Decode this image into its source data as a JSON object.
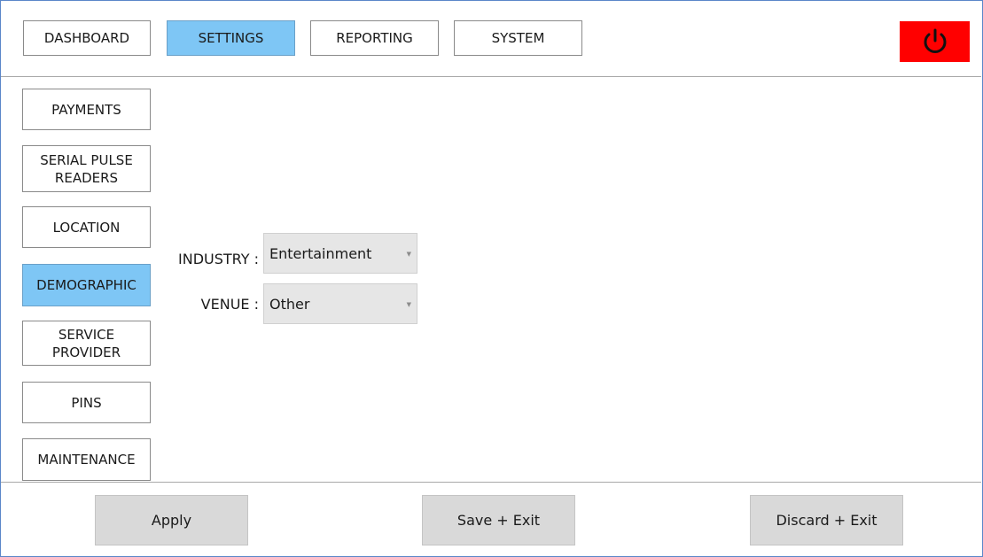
{
  "topnav": {
    "dashboard": "DASHBOARD",
    "settings": "SETTINGS",
    "reporting": "REPORTING",
    "system": "SYSTEM",
    "active": "SETTINGS"
  },
  "sidebar": {
    "items": [
      {
        "label": "PAYMENTS"
      },
      {
        "label": "SERIAL PULSE\nREADERS"
      },
      {
        "label": "LOCATION"
      },
      {
        "label": "DEMOGRAPHIC"
      },
      {
        "label": "SERVICE\nPROVIDER"
      },
      {
        "label": "PINS"
      },
      {
        "label": "MAINTENANCE"
      }
    ],
    "active": "DEMOGRAPHIC"
  },
  "form": {
    "industry_label": "INDUSTRY :",
    "industry_value": "Entertainment",
    "venue_label": "VENUE :",
    "venue_value": "Other"
  },
  "footer": {
    "apply": "Apply",
    "save_exit": "Save + Exit",
    "discard_exit": "Discard + Exit"
  },
  "colors": {
    "active": "#7ec6f5",
    "power": "#ff0000",
    "footer_button": "#d9d9d9",
    "frame": "#5b87c9"
  },
  "icons": {
    "power": "power-icon",
    "dropdown": "chevron-down-icon"
  }
}
